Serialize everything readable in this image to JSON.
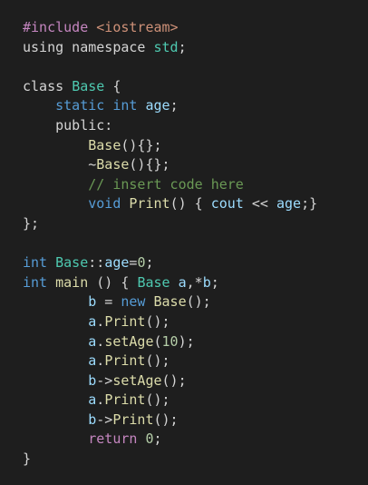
{
  "code": {
    "lines": [
      [
        [
          "#include ",
          "preproc"
        ],
        [
          "<iostream>",
          "string"
        ]
      ],
      [
        [
          "using namespace ",
          "plain"
        ],
        [
          "std",
          "type"
        ],
        [
          ";",
          "plain"
        ]
      ],
      [],
      [
        [
          "class ",
          "plain"
        ],
        [
          "Base",
          "type"
        ],
        [
          " {",
          "plain"
        ]
      ],
      [
        [
          "    ",
          "plain"
        ],
        [
          "static",
          "keyword"
        ],
        [
          " ",
          "plain"
        ],
        [
          "int",
          "keyword"
        ],
        [
          " ",
          "plain"
        ],
        [
          "age",
          "var"
        ],
        [
          ";",
          "plain"
        ]
      ],
      [
        [
          "    public:",
          "plain"
        ]
      ],
      [
        [
          "        ",
          "plain"
        ],
        [
          "Base",
          "func"
        ],
        [
          "(){};",
          "plain"
        ]
      ],
      [
        [
          "        ~",
          "plain"
        ],
        [
          "Base",
          "func"
        ],
        [
          "(){};",
          "plain"
        ]
      ],
      [
        [
          "        ",
          "plain"
        ],
        [
          "// insert code here",
          "comment"
        ]
      ],
      [
        [
          "        ",
          "plain"
        ],
        [
          "void",
          "keyword"
        ],
        [
          " ",
          "plain"
        ],
        [
          "Print",
          "func"
        ],
        [
          "() { ",
          "plain"
        ],
        [
          "cout",
          "var"
        ],
        [
          " << ",
          "plain"
        ],
        [
          "age",
          "var"
        ],
        [
          ";}",
          "plain"
        ]
      ],
      [
        [
          "};",
          "plain"
        ]
      ],
      [],
      [
        [
          "int",
          "keyword"
        ],
        [
          " ",
          "plain"
        ],
        [
          "Base",
          "type"
        ],
        [
          "::",
          "plain"
        ],
        [
          "age",
          "var"
        ],
        [
          "=",
          "plain"
        ],
        [
          "0",
          "number"
        ],
        [
          ";",
          "plain"
        ]
      ],
      [
        [
          "int",
          "keyword"
        ],
        [
          " ",
          "plain"
        ],
        [
          "main",
          "func"
        ],
        [
          " () { ",
          "plain"
        ],
        [
          "Base",
          "type"
        ],
        [
          " ",
          "plain"
        ],
        [
          "a",
          "var"
        ],
        [
          ",*",
          "plain"
        ],
        [
          "b",
          "var"
        ],
        [
          ";",
          "plain"
        ]
      ],
      [
        [
          "        ",
          "plain"
        ],
        [
          "b",
          "var"
        ],
        [
          " = ",
          "plain"
        ],
        [
          "new",
          "keyword"
        ],
        [
          " ",
          "plain"
        ],
        [
          "Base",
          "func"
        ],
        [
          "();",
          "plain"
        ]
      ],
      [
        [
          "        ",
          "plain"
        ],
        [
          "a",
          "var"
        ],
        [
          ".",
          "plain"
        ],
        [
          "Print",
          "func"
        ],
        [
          "();",
          "plain"
        ]
      ],
      [
        [
          "        ",
          "plain"
        ],
        [
          "a",
          "var"
        ],
        [
          ".",
          "plain"
        ],
        [
          "setAge",
          "func"
        ],
        [
          "(",
          "plain"
        ],
        [
          "10",
          "number"
        ],
        [
          ");",
          "plain"
        ]
      ],
      [
        [
          "        ",
          "plain"
        ],
        [
          "a",
          "var"
        ],
        [
          ".",
          "plain"
        ],
        [
          "Print",
          "func"
        ],
        [
          "();",
          "plain"
        ]
      ],
      [
        [
          "        ",
          "plain"
        ],
        [
          "b",
          "var"
        ],
        [
          "->",
          "plain"
        ],
        [
          "setAge",
          "func"
        ],
        [
          "();",
          "plain"
        ]
      ],
      [
        [
          "        ",
          "plain"
        ],
        [
          "a",
          "var"
        ],
        [
          ".",
          "plain"
        ],
        [
          "Print",
          "func"
        ],
        [
          "();",
          "plain"
        ]
      ],
      [
        [
          "        ",
          "plain"
        ],
        [
          "b",
          "var"
        ],
        [
          "->",
          "plain"
        ],
        [
          "Print",
          "func"
        ],
        [
          "();",
          "plain"
        ]
      ],
      [
        [
          "        ",
          "plain"
        ],
        [
          "return",
          "control"
        ],
        [
          " ",
          "plain"
        ],
        [
          "0",
          "number"
        ],
        [
          ";",
          "plain"
        ]
      ],
      [
        [
          "}",
          "plain"
        ]
      ]
    ]
  },
  "colors": {
    "background": "#1e1e1e",
    "plain": "#d4d4d4",
    "keyword": "#569cd6",
    "control": "#c586c0",
    "preproc": "#c586c0",
    "string": "#ce9178",
    "type": "#4ec9b0",
    "function": "#dcdcaa",
    "variable": "#9cdcfe",
    "number": "#b5cea8",
    "comment": "#6a9955"
  }
}
